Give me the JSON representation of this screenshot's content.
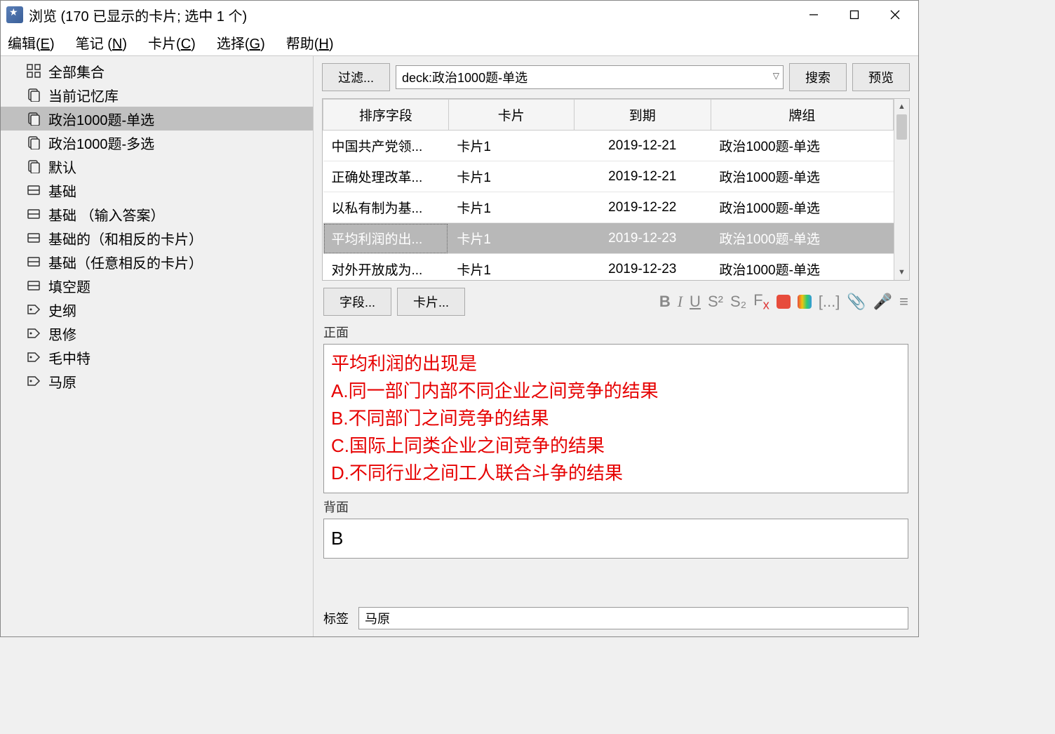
{
  "window": {
    "title": "浏览  (170 已显示的卡片; 选中 1 个)"
  },
  "menu": {
    "edit": "编辑",
    "edit_key": "E",
    "notes": "笔记",
    "notes_key": "N",
    "cards": "卡片",
    "cards_key": "C",
    "select": "选择",
    "select_key": "G",
    "help": "帮助",
    "help_key": "H"
  },
  "sidebar": {
    "items": [
      {
        "icon": "grid",
        "label": "全部集合"
      },
      {
        "icon": "deck",
        "label": "当前记忆库"
      },
      {
        "icon": "deck",
        "label": "政治1000题-单选",
        "selected": true
      },
      {
        "icon": "deck",
        "label": "政治1000题-多选"
      },
      {
        "icon": "deck",
        "label": "默认"
      },
      {
        "icon": "note",
        "label": "基础"
      },
      {
        "icon": "note",
        "label": "基础 （输入答案）"
      },
      {
        "icon": "note",
        "label": "基础的（和相反的卡片）"
      },
      {
        "icon": "note",
        "label": "基础（任意相反的卡片）"
      },
      {
        "icon": "note",
        "label": "填空题"
      },
      {
        "icon": "tag",
        "label": "史纲"
      },
      {
        "icon": "tag",
        "label": "思修"
      },
      {
        "icon": "tag",
        "label": "毛中特"
      },
      {
        "icon": "tag",
        "label": "马原"
      }
    ]
  },
  "searchbar": {
    "filter": "过滤...",
    "query": "deck:政治1000题-单选",
    "search": "搜索",
    "preview": "预览"
  },
  "table": {
    "headers": {
      "sort": "排序字段",
      "card": "卡片",
      "due": "到期",
      "deck": "牌组"
    },
    "rows": [
      {
        "sort": "中国共产党领...",
        "card": "卡片1",
        "due": "2019-12-21",
        "deck": "政治1000题-单选"
      },
      {
        "sort": "正确处理改革...",
        "card": "卡片1",
        "due": "2019-12-21",
        "deck": "政治1000题-单选"
      },
      {
        "sort": "以私有制为基...",
        "card": "卡片1",
        "due": "2019-12-22",
        "deck": "政治1000题-单选"
      },
      {
        "sort": "平均利润的出...",
        "card": "卡片1",
        "due": "2019-12-23",
        "deck": "政治1000题-单选",
        "selected": true
      },
      {
        "sort": "对外开放成为...",
        "card": "卡片1",
        "due": "2019-12-23",
        "deck": "政治1000题-单选"
      }
    ]
  },
  "editor": {
    "fields_btn": "字段...",
    "cards_btn": "卡片...",
    "front_label": "正面",
    "front_lines": [
      "平均利润的出现是",
      "A.同一部门内部不同企业之间竞争的结果",
      "B.不同部门之间竞争的结果",
      "C.国际上同类企业之间竞争的结果",
      "D.不同行业之间工人联合斗争的结果"
    ],
    "back_label": "背面",
    "back_value": "B",
    "tags_label": "标签",
    "tags_value": "马原"
  }
}
